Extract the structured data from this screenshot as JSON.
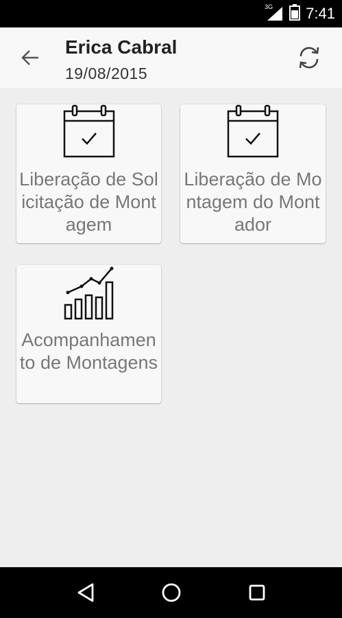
{
  "status_bar": {
    "time": "7:41",
    "network_label": "3G",
    "icons": [
      "signal-icon",
      "battery-icon"
    ]
  },
  "header": {
    "title": "Erica Cabral",
    "date": "19/08/2015",
    "back_icon": "arrow-back-icon",
    "refresh_icon": "refresh-icon"
  },
  "menu": {
    "items": [
      {
        "label": "Liberação de Solicitação de Montagem",
        "icon": "calendar-check-icon"
      },
      {
        "label": "Liberação de Montagem do Montador",
        "icon": "calendar-check-icon"
      },
      {
        "label": "Acompanhamento de Montagens",
        "icon": "bar-chart-icon"
      }
    ]
  },
  "nav_bar": {
    "icons": [
      "back-triangle-icon",
      "home-circle-icon",
      "recents-square-icon"
    ]
  },
  "colors": {
    "status_bar": "#000000",
    "app_bar": "#f8f8f8",
    "background": "#eeeeee",
    "card": "#f8f8f8",
    "label": "#777777"
  }
}
